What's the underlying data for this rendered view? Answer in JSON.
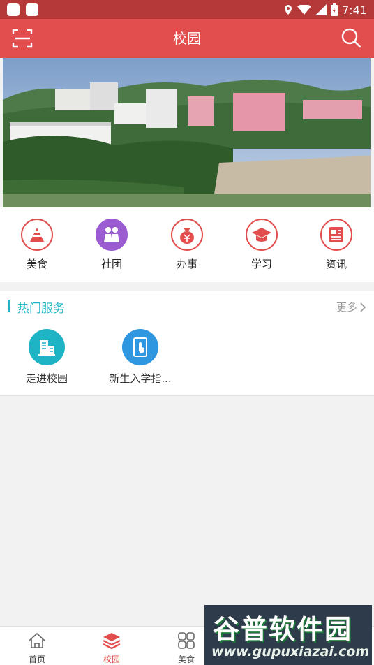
{
  "status": {
    "time": "7:41"
  },
  "header": {
    "title": "校园"
  },
  "quick_menu": [
    {
      "label": "美食",
      "icon": "food-icon"
    },
    {
      "label": "社团",
      "icon": "club-icon"
    },
    {
      "label": "办事",
      "icon": "money-bag-icon"
    },
    {
      "label": "学习",
      "icon": "graduation-cap-icon"
    },
    {
      "label": "资讯",
      "icon": "news-icon"
    }
  ],
  "hot_services": {
    "title": "热门服务",
    "more": "更多",
    "items": [
      {
        "label": "走进校园",
        "icon": "building-icon",
        "color": "#1eb4c6"
      },
      {
        "label": "新生入学指...",
        "icon": "tablet-icon",
        "color": "#2f96e0"
      }
    ]
  },
  "tabbar": [
    {
      "label": "首页",
      "icon": "home-icon"
    },
    {
      "label": "校园",
      "icon": "layers-icon",
      "active": true
    },
    {
      "label": "美食",
      "icon": "grid-icon"
    }
  ],
  "watermark": {
    "title": "谷普软件园",
    "url": "www.gupuxiazai.com"
  },
  "colors": {
    "primary": "#e24d4d",
    "status": "#b6393a",
    "accent": "#1eb4c6"
  }
}
